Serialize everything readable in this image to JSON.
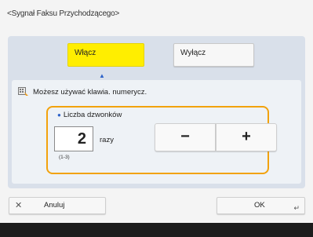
{
  "window": {
    "title": "<Sygnał Faksu Przychodzącego>"
  },
  "toggle": {
    "on_label": "Włącz",
    "off_label": "Wyłącz"
  },
  "hint": {
    "text": "Możesz używać klawia. numerycz."
  },
  "rings": {
    "label": "Liczba dzwonków",
    "value": "2",
    "unit": "razy",
    "range": "(1-3)",
    "minus_label": "−",
    "plus_label": "+"
  },
  "buttons": {
    "cancel_label": "Anuluj",
    "ok_label": "OK"
  },
  "icons": {
    "cancel": "close-icon",
    "ok": "return-icon",
    "hint": "keypad-icon",
    "indicator": "triangle-up-icon"
  },
  "colors": {
    "selected": "#ffee00",
    "focus_border": "#f2a20c",
    "panel": "#d9e0ea"
  }
}
